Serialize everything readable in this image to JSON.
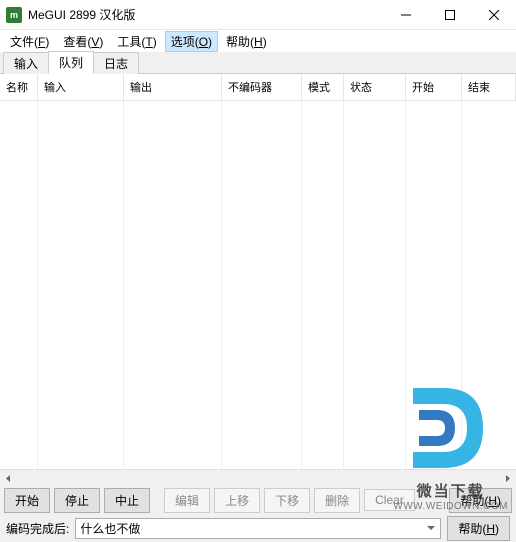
{
  "window": {
    "title": "MeGUI 2899 汉化版",
    "icon_text": "m"
  },
  "menubar": {
    "items": [
      {
        "label": "文件(",
        "key": "F",
        "suffix": ")"
      },
      {
        "label": "查看(",
        "key": "V",
        "suffix": ")"
      },
      {
        "label": "工具(",
        "key": "T",
        "suffix": ")"
      },
      {
        "label": "选项(",
        "key": "O",
        "suffix": ")",
        "active": true
      },
      {
        "label": "帮助(",
        "key": "H",
        "suffix": ")"
      }
    ]
  },
  "tabs": {
    "items": [
      {
        "label": "输入"
      },
      {
        "label": "队列",
        "active": true
      },
      {
        "label": "日志"
      }
    ]
  },
  "table": {
    "columns": {
      "name": "名称",
      "input": "输入",
      "output": "输出",
      "codec": "不编码器",
      "mode": "模式",
      "status": "状态",
      "start": "开始",
      "end": "结束"
    },
    "rows": []
  },
  "buttons": {
    "start": "开始",
    "stop": "停止",
    "abort": "中止",
    "edit": "编辑",
    "up": "上移",
    "down": "下移",
    "delete": "删除",
    "clear": "Clear",
    "help": "帮助(",
    "help_key": "H",
    "help_suffix": ")"
  },
  "footer": {
    "label": "编码完成后:",
    "combo_value": "什么也不做"
  },
  "watermark": {
    "brand": "微当下载",
    "url": "WWW.WEIDOWN.COM"
  }
}
